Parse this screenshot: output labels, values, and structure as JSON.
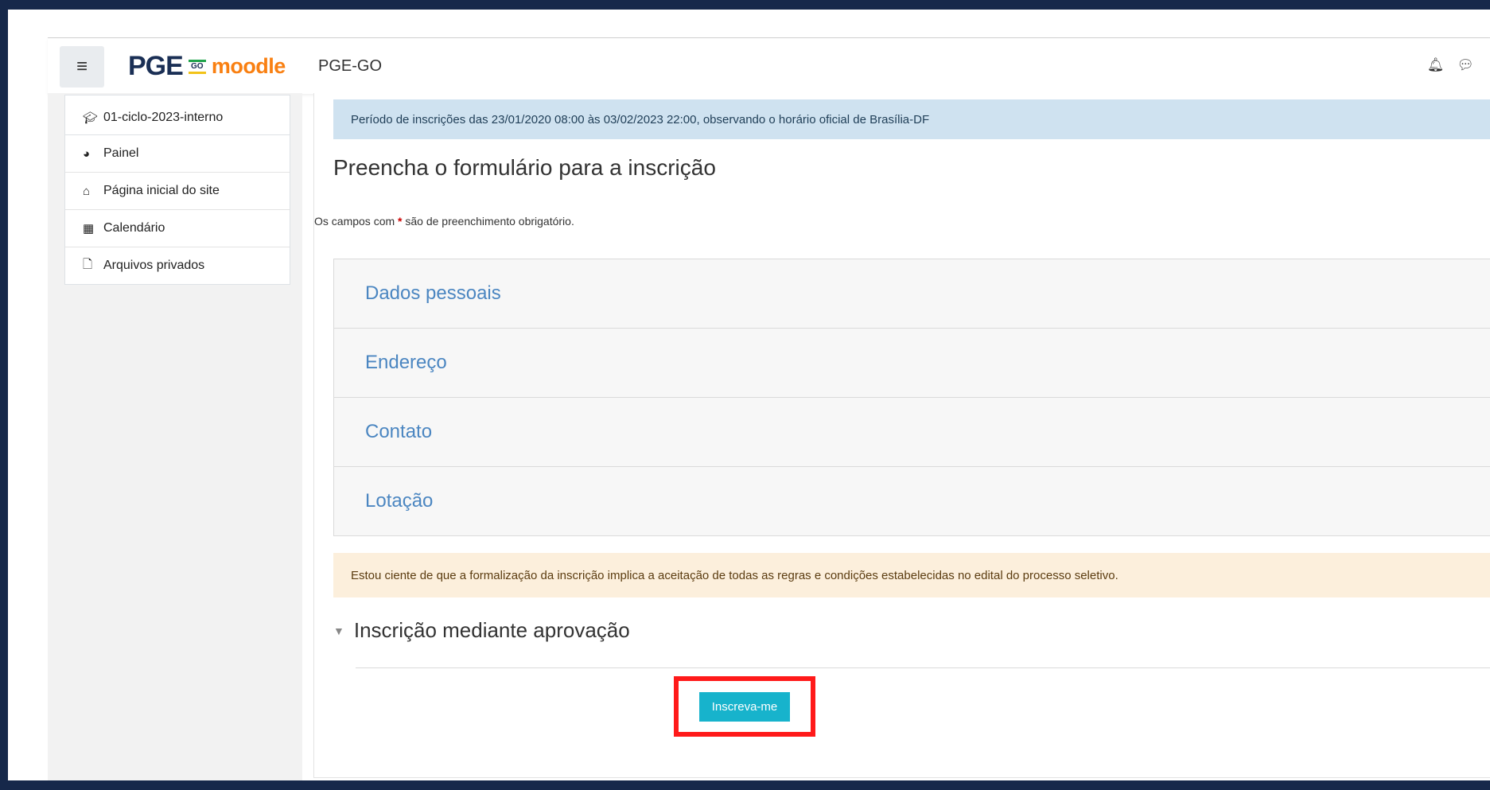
{
  "header": {
    "menu_icon": "hamburger-icon",
    "logo_text": "PGE",
    "logo_badge": "GO",
    "logo_moodle": "moodle",
    "site_name": "PGE-GO",
    "icons": [
      "bell-icon",
      "chat-icon"
    ],
    "colors": {
      "logo_navy": "#1a2f55",
      "moodle_orange": "#f98012"
    }
  },
  "sidebar": {
    "course": {
      "label": "01-ciclo-2023-interno",
      "icon": "graduation-cap-icon"
    },
    "items": [
      {
        "label": "Painel",
        "icon": "dashboard-icon"
      },
      {
        "label": "Página inicial do site",
        "icon": "home-icon"
      },
      {
        "label": "Calendário",
        "icon": "calendar-icon"
      },
      {
        "label": "Arquivos privados",
        "icon": "file-icon"
      }
    ]
  },
  "main": {
    "info_banner": "Período de inscrições das 23/01/2020 08:00 às 03/02/2023 22:00, observando o horário oficial de Brasília-DF",
    "form_title": "Preencha o formulário para a inscrição",
    "required_note_before": "Os campos com ",
    "required_star": "*",
    "required_note_after": " são de preenchimento obrigatório.",
    "sections": [
      "Dados pessoais",
      "Endereço",
      "Contato",
      "Lotação"
    ],
    "warning_banner": "Estou ciente de que a formalização da inscrição implica a aceitação de todas as regras e condições estabelecidas no edital do processo seletivo.",
    "collapse_title": "Inscrição mediante aprovação",
    "enroll_button": "Inscreva-me",
    "colors": {
      "info_bg": "#cfe2f0",
      "warning_bg": "#fcefdc",
      "button": "#17b3cc",
      "highlight": "#ff1a1a",
      "section_link": "#4b86c1"
    }
  }
}
